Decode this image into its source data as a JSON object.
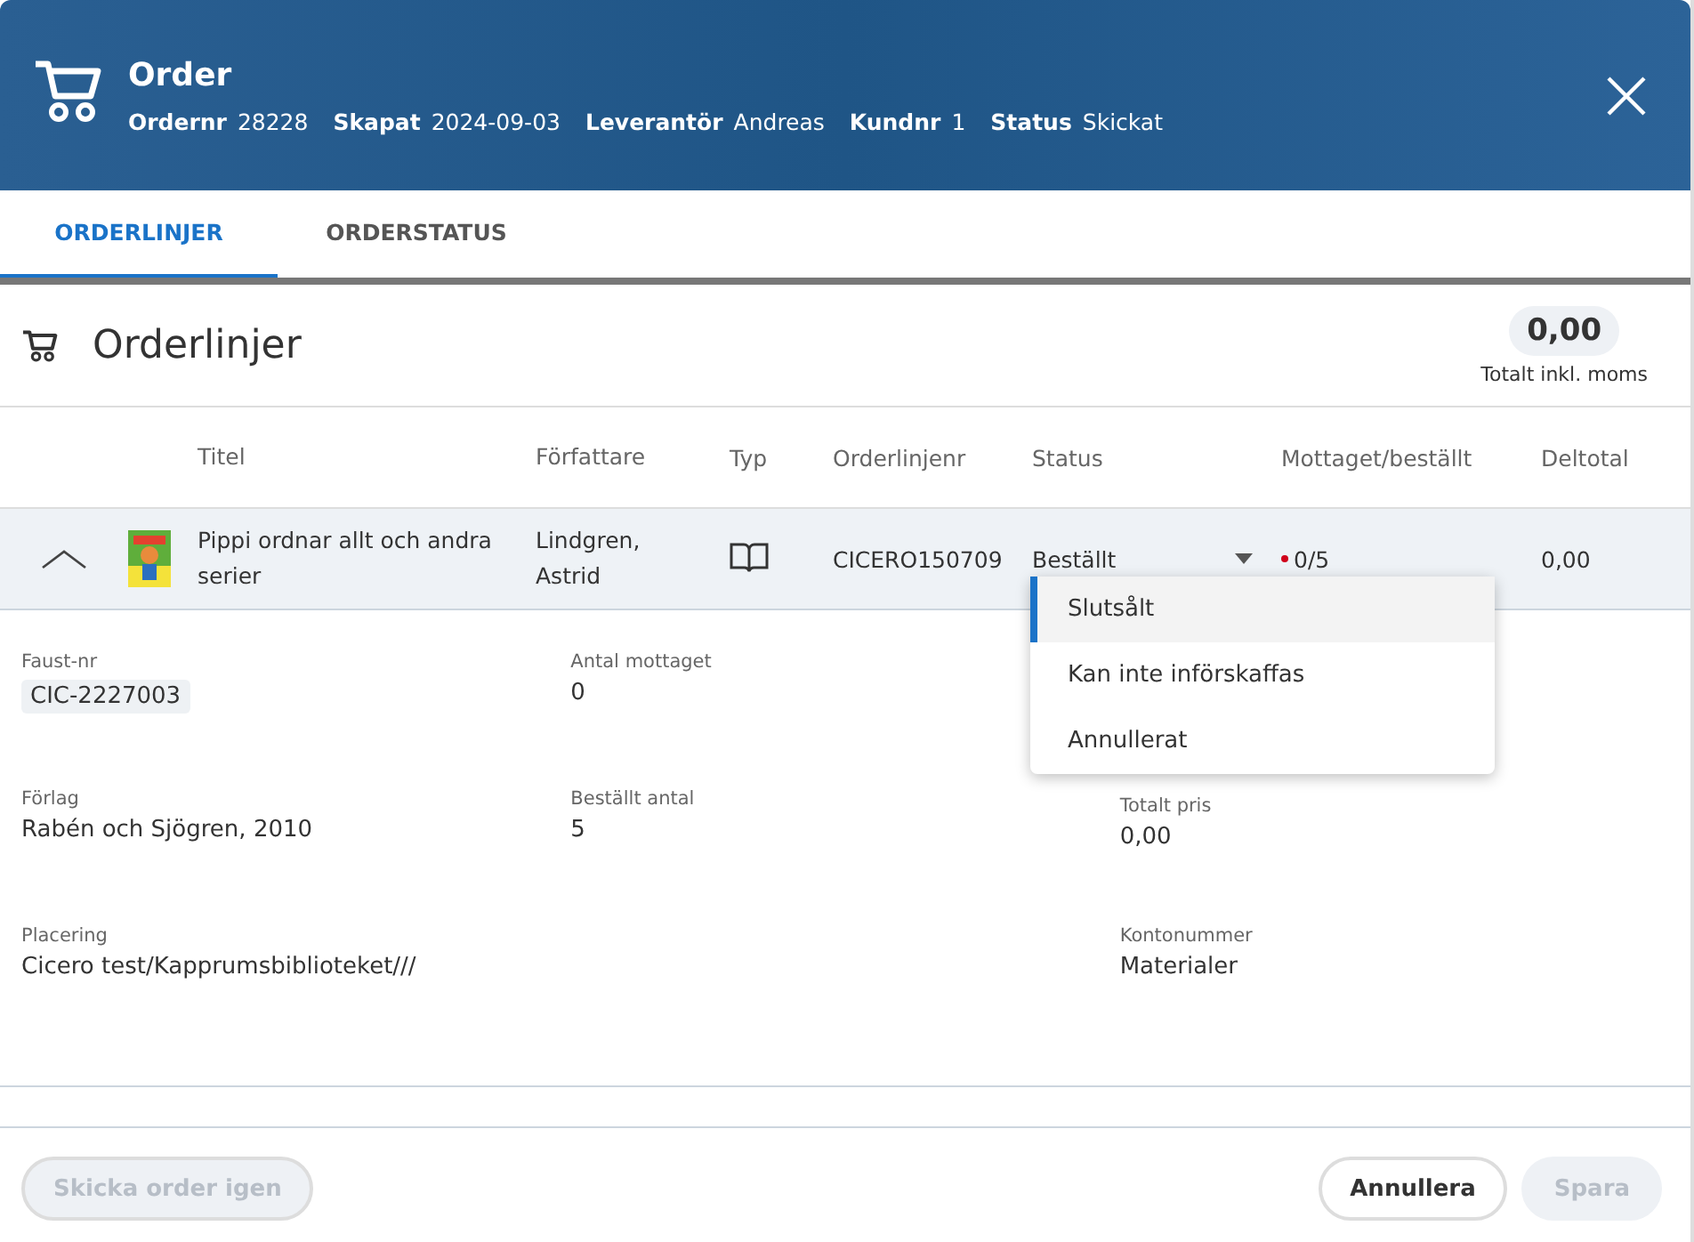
{
  "header": {
    "title": "Order",
    "meta": [
      {
        "label": "Ordernr",
        "value": "28228"
      },
      {
        "label": "Skapat",
        "value": "2024-09-03"
      },
      {
        "label": "Leverantör",
        "value": "Andreas"
      },
      {
        "label": "Kundnr",
        "value": "1"
      },
      {
        "label": "Status",
        "value": "Skickat"
      }
    ]
  },
  "tabs": [
    {
      "label": "ORDERLINJER",
      "selected": true
    },
    {
      "label": "ORDERSTATUS",
      "selected": false
    }
  ],
  "section": {
    "title": "Orderlinjer",
    "total": "0,00",
    "total_label": "Totalt inkl. moms"
  },
  "table": {
    "columns": [
      "Titel",
      "Författare",
      "Typ",
      "Orderlinjenr",
      "Status",
      "Mottaget/beställt",
      "Deltotal"
    ],
    "rows": [
      {
        "expanded": true,
        "title": "Pippi ordnar allt och andra serier",
        "author": "Lindgren, Astrid",
        "orderline": "CICERO150709",
        "status": "Beställt",
        "status_open": true,
        "received": "0/5",
        "subtotal": "0,00"
      }
    ]
  },
  "status_menu": [
    {
      "label": "Slutsålt",
      "selected": true
    },
    {
      "label": "Kan inte införskaffas",
      "selected": false
    },
    {
      "label": "Annullerat",
      "selected": false
    }
  ],
  "details": [
    [
      {
        "label": "Faust-nr",
        "value": "CIC-2227003",
        "kind": "chip"
      },
      {
        "label": "Förlag",
        "value": "Rabén och Sjögren, 2010",
        "kind": "text"
      },
      {
        "label": "Placering",
        "value": "Cicero test/Kapprumsbiblioteket///",
        "kind": "text"
      }
    ],
    [
      {
        "label": "Antal mottaget",
        "value": "0",
        "kind": "text"
      },
      {
        "label": "Beställt antal",
        "value": "5",
        "kind": "text"
      }
    ],
    [
      {
        "label": "Totalt pris",
        "value": "0,00",
        "kind": "text"
      },
      {
        "label": "Kontonummer",
        "value": "Materialer",
        "kind": "text"
      }
    ]
  ],
  "footer": {
    "resend": {
      "label": "Skicka order igen",
      "disabled": true
    },
    "cancel": {
      "label": "Annullera",
      "disabled": false
    },
    "save": {
      "label": "Spara",
      "disabled": true
    }
  }
}
